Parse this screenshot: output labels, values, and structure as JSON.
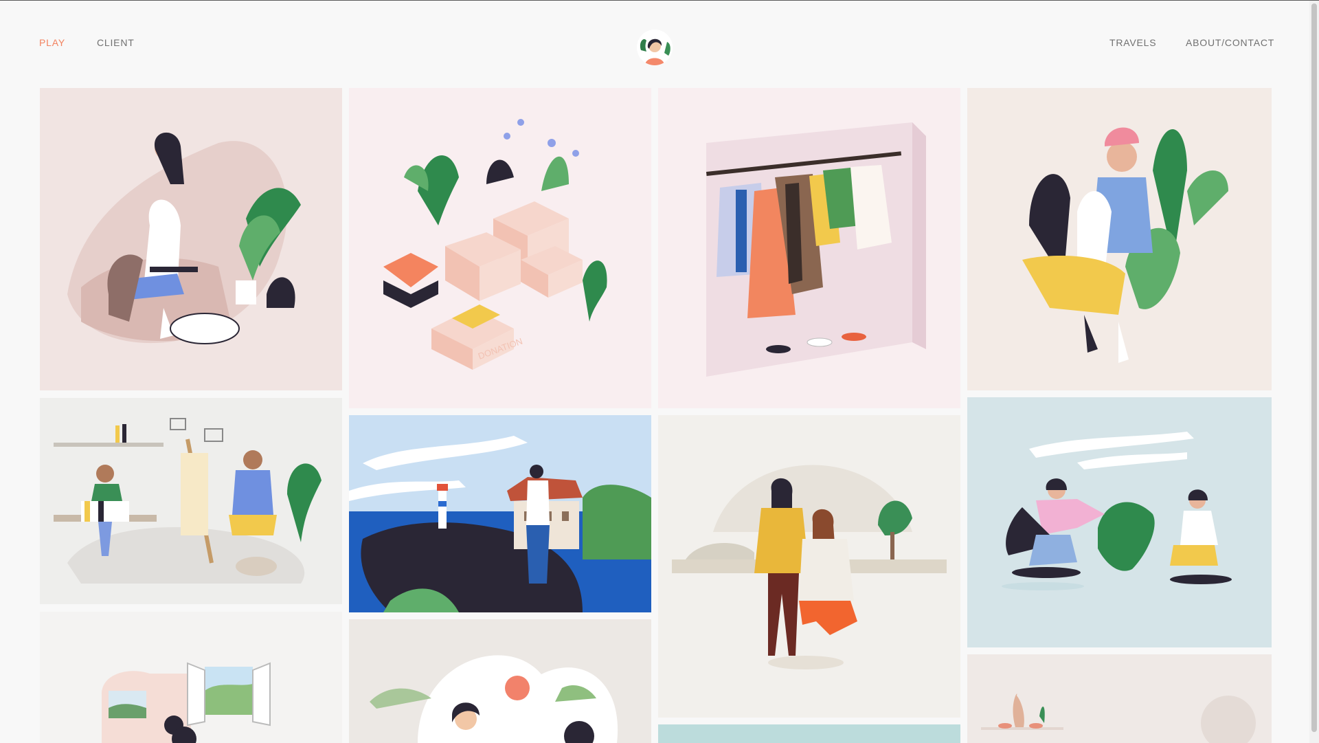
{
  "nav": {
    "play": "PLAY",
    "client": "CLIENT",
    "travels": "TRAVELS",
    "about_contact": "ABOUT/CONTACT"
  },
  "colors": {
    "accent": "#f2825f",
    "nav_text": "#707070",
    "page_background": "#f8f8f8"
  },
  "gallery": {
    "donation_box_label": "DONATION"
  }
}
